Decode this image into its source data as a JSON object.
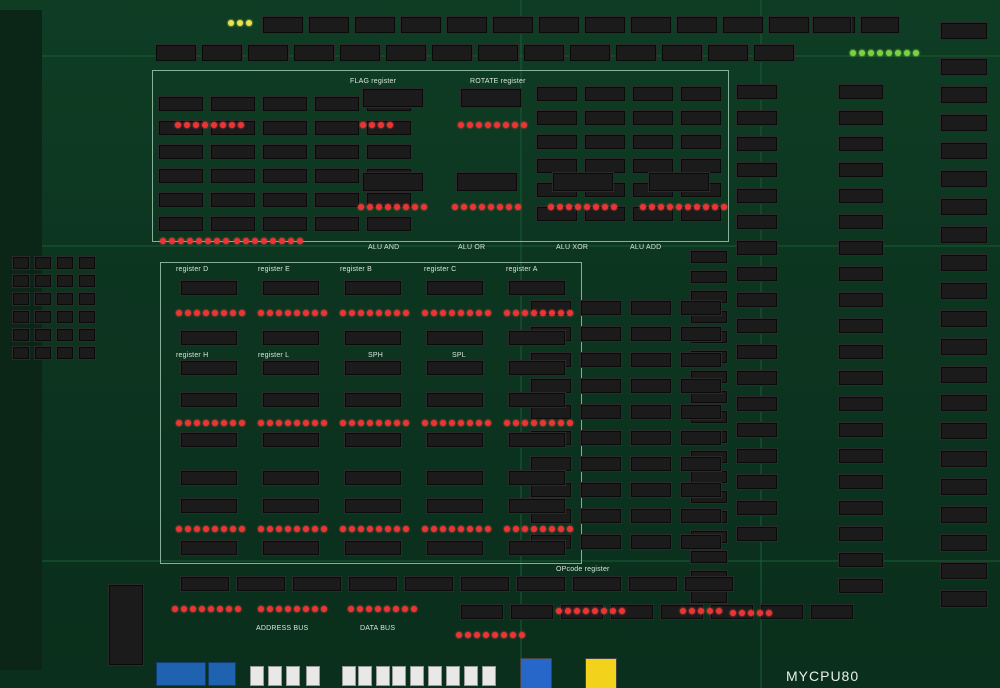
{
  "board": {
    "brand": "MYCPU80",
    "labels": {
      "flag": "FLAG register",
      "rotate": "ROTATE register",
      "alu_and": "ALU AND",
      "alu_or": "ALU OR",
      "alu_xor": "ALU XOR",
      "alu_add": "ALU ADD",
      "reg_d": "register D",
      "reg_e": "register E",
      "reg_b": "register B",
      "reg_c": "register C",
      "reg_a": "register A",
      "reg_h": "register H",
      "reg_l": "register L",
      "sph": "SPH",
      "spl": "SPL",
      "opcode": "OPcode register",
      "address_bus": "ADDRESS BUS",
      "data_bus": "DATA BUS"
    },
    "colors": {
      "pcb": "#0c3520",
      "chip": "#1b1b1b",
      "led_red": "#e33333",
      "led_yellow": "#e7e34a",
      "led_green": "#7bd13e",
      "dip_switch": "#1e62b0",
      "button_blue": "#2767c9",
      "button_yellow": "#f2d21b"
    }
  }
}
